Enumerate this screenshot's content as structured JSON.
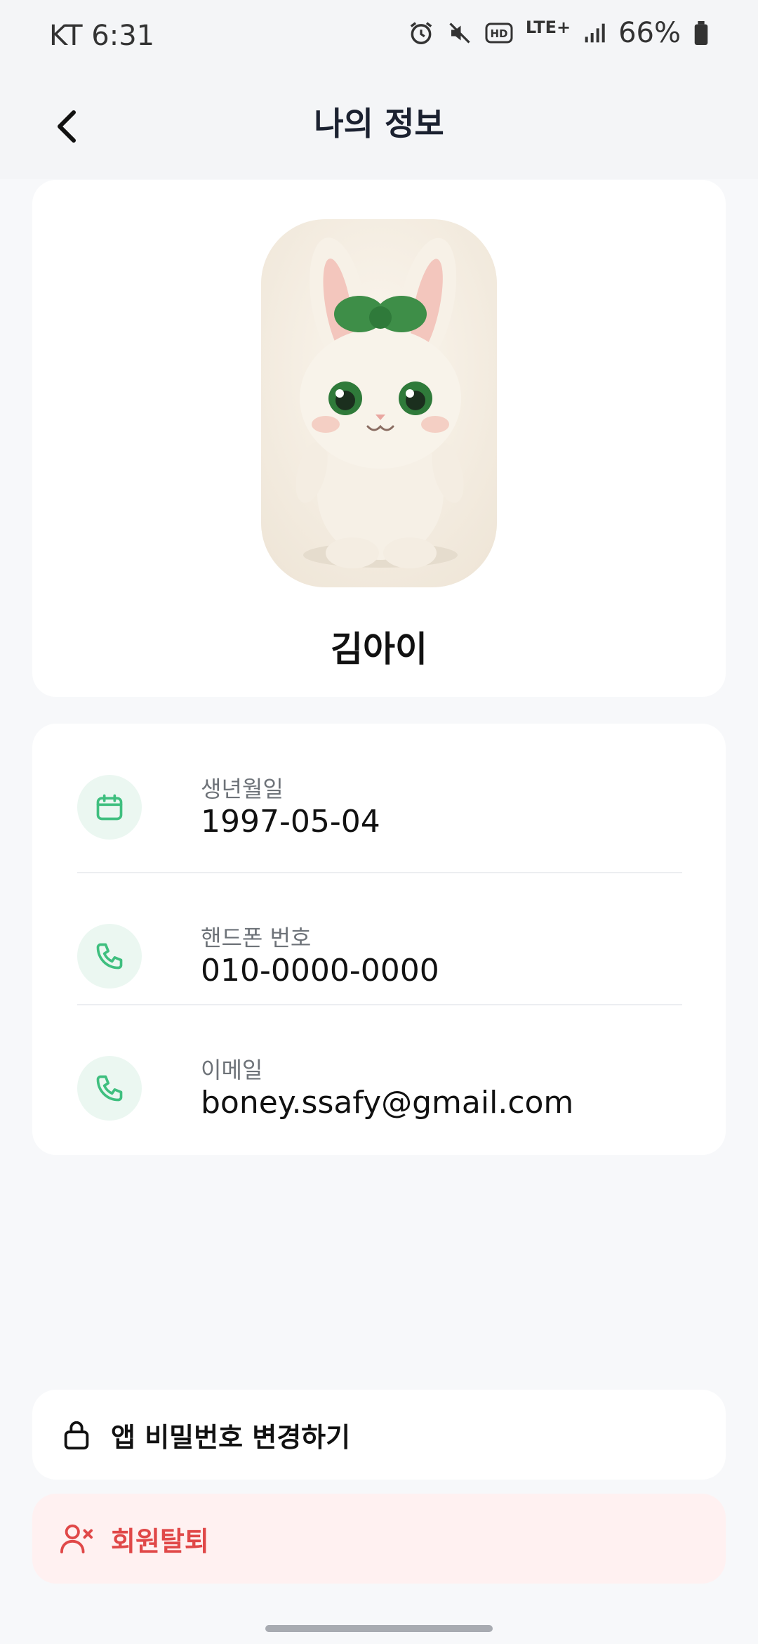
{
  "status_bar": {
    "carrier_time": "KT 6:31",
    "network": "LTE+",
    "battery": "66%",
    "icons": [
      "alarm-icon",
      "mute-icon",
      "hd-icon",
      "lte-icon",
      "signal-icon",
      "battery-icon"
    ]
  },
  "header": {
    "title": "나의 정보",
    "back_icon": "chevron-left-icon"
  },
  "profile": {
    "name": "김아이",
    "avatar": "bunny-avatar"
  },
  "info": [
    {
      "label": "생년월일",
      "value": "1997-05-04",
      "icon": "calendar-icon"
    },
    {
      "label": "핸드폰 번호",
      "value": "010-0000-0000",
      "icon": "phone-icon"
    },
    {
      "label": "이메일",
      "value": "boney.ssafy@gmail.com",
      "icon": "phone-icon"
    }
  ],
  "actions": {
    "change_password": "앱 비밀번호 변경하기",
    "withdraw": "회원탈퇴"
  },
  "colors": {
    "accent_green": "#3fbf7f",
    "danger_red": "#e04848",
    "danger_bg": "#fff1f1"
  }
}
